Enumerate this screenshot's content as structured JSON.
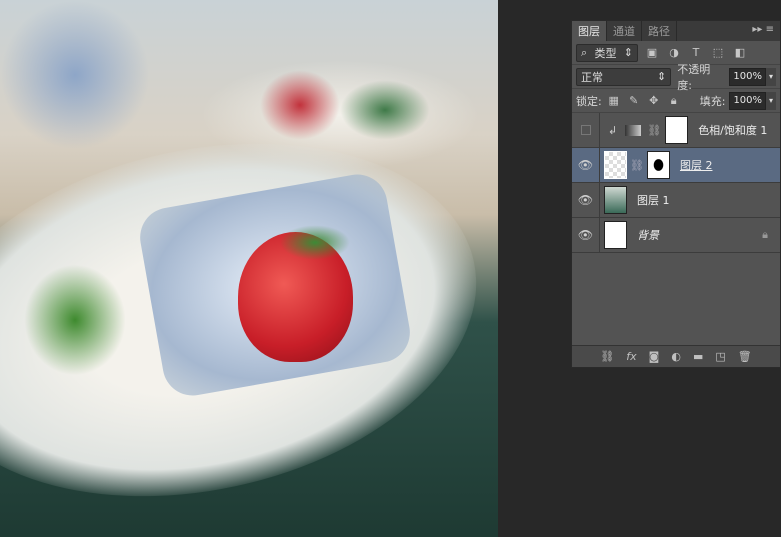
{
  "panel": {
    "tabs": [
      "图层",
      "通道",
      "路径"
    ],
    "menu_icon": "panel-menu-icon",
    "filter": {
      "label": "类型",
      "icon": "search-icon"
    },
    "filter_icons": [
      "image-filter-icon",
      "adjustment-filter-icon",
      "type-filter-icon",
      "shape-filter-icon",
      "smart-object-filter-icon"
    ],
    "blend_mode": "正常",
    "opacity_label": "不透明度:",
    "opacity": "100%",
    "lock_label": "锁定:",
    "fill_label": "填充:",
    "fill": "100%",
    "layers": [
      {
        "name": "色相/饱和度 1",
        "visible": false,
        "type": "adjustment"
      },
      {
        "name": "图层 2",
        "visible": true,
        "selected": true,
        "mask": true
      },
      {
        "name": "图层 1",
        "visible": true
      },
      {
        "name": "背景",
        "visible": true,
        "locked": true
      }
    ],
    "footer_icons": [
      "link-icon",
      "fx-icon",
      "mask-icon",
      "adjustment-icon",
      "folder-icon",
      "new-layer-icon",
      "trash-icon"
    ]
  }
}
